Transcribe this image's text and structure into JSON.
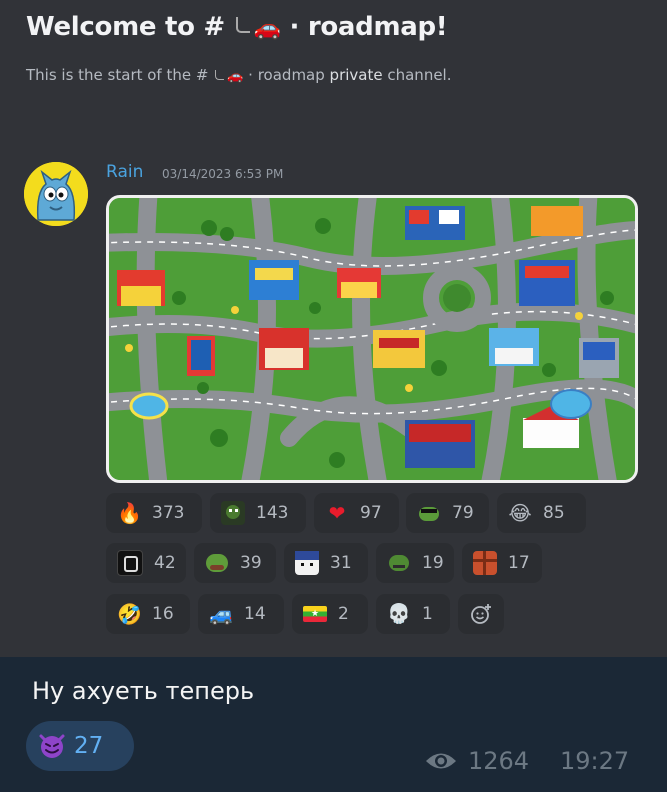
{
  "channel": {
    "welcome_prefix": "Welcome to # ",
    "welcome_suffix": " · roadmap!",
    "subtitle_prefix": "This is the start of the # ",
    "subtitle_mid": " · roadmap ",
    "subtitle_bold": "private",
    "subtitle_end": " channel.",
    "channel_icons": [
      "branch-arrow-icon",
      "red-car-icon"
    ]
  },
  "message": {
    "author": "Rain",
    "timestamp": "03/14/2023 6:53 PM",
    "avatar_icon": "blue-cat-avatar",
    "attachment": "city road map carpet image",
    "reactions": [
      {
        "icon": "fire-icon",
        "glyph": "🔥",
        "count": "373"
      },
      {
        "icon": "frog-emote-icon",
        "glyph": "",
        "count": "143"
      },
      {
        "icon": "red-heart-icon",
        "glyph": "❤",
        "count": "97"
      },
      {
        "icon": "frog-sunglasses-icon",
        "glyph": "",
        "count": "79"
      },
      {
        "icon": "laughing-tears-icon",
        "glyph": "😂",
        "count": "85"
      },
      {
        "icon": "pixel-emote-icon",
        "glyph": "",
        "count": "42"
      },
      {
        "icon": "pepe-icon",
        "glyph": "",
        "count": "39"
      },
      {
        "icon": "anime-face-icon",
        "glyph": "",
        "count": "31"
      },
      {
        "icon": "pepe-sad-icon",
        "glyph": "",
        "count": "19"
      },
      {
        "icon": "pixel-brick-icon",
        "glyph": "",
        "count": "17"
      },
      {
        "icon": "rofl-icon",
        "glyph": "🤣",
        "count": "16"
      },
      {
        "icon": "blue-car-icon",
        "glyph": "🚙",
        "count": "14"
      },
      {
        "icon": "myanmar-flag-icon",
        "glyph": "",
        "count": "2"
      },
      {
        "icon": "skull-icon",
        "glyph": "💀",
        "count": "1"
      }
    ],
    "add_reaction_icon": "add-reaction-icon"
  },
  "telegram": {
    "text": "Ну ахуеть теперь",
    "reaction": {
      "icon": "smiling-devil-icon",
      "glyph": "😈",
      "count": "27"
    },
    "views": "1264",
    "time": "19:27",
    "colors": {
      "background": "#1b2836",
      "reaction_bg": "#27415e",
      "reaction_count": "#62b0f3",
      "meta": "#6c7883"
    }
  },
  "colors": {
    "discord_bg": "#313338",
    "author": "#4aa3df",
    "reaction_bg": "#2b2d31"
  }
}
